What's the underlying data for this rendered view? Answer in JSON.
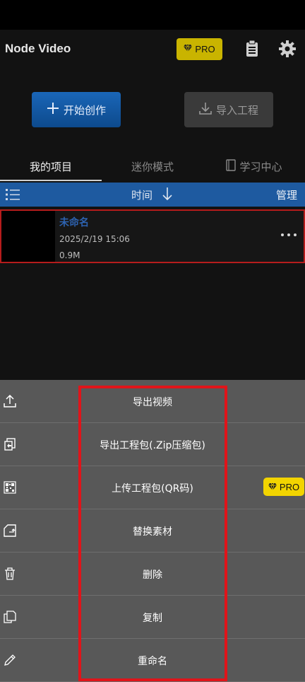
{
  "header": {
    "title": "Node Video",
    "pro_badge": "PRO",
    "clipboard_icon": "clipboard-icon",
    "settings_icon": "gear-icon"
  },
  "actions": {
    "create_label": "开始创作",
    "import_label": "导入工程"
  },
  "tabs": [
    {
      "label": "我的项目",
      "active": true
    },
    {
      "label": "迷你模式",
      "active": false
    },
    {
      "label": "学习中心",
      "active": false
    }
  ],
  "sortbar": {
    "sort_label": "时间",
    "manage_label": "管理"
  },
  "project": {
    "name": "未命名",
    "date": "2025/2/19 15:06",
    "size": "0.9M"
  },
  "menu": [
    {
      "label": "导出视频",
      "icon": "upload-icon"
    },
    {
      "label": "导出工程包(.Zip压缩包)",
      "icon": "export-package-icon"
    },
    {
      "label": "上传工程包(QR码)",
      "icon": "qr-code-icon",
      "pro": "PRO"
    },
    {
      "label": "替换素材",
      "icon": "replace-icon"
    },
    {
      "label": "删除",
      "icon": "trash-icon"
    },
    {
      "label": "复制",
      "icon": "copy-icon"
    },
    {
      "label": "重命名",
      "icon": "pencil-icon"
    }
  ],
  "colors": {
    "accent_blue": "#1e5aa0",
    "pro_yellow": "#f2d400",
    "highlight_red": "#e0141a"
  }
}
